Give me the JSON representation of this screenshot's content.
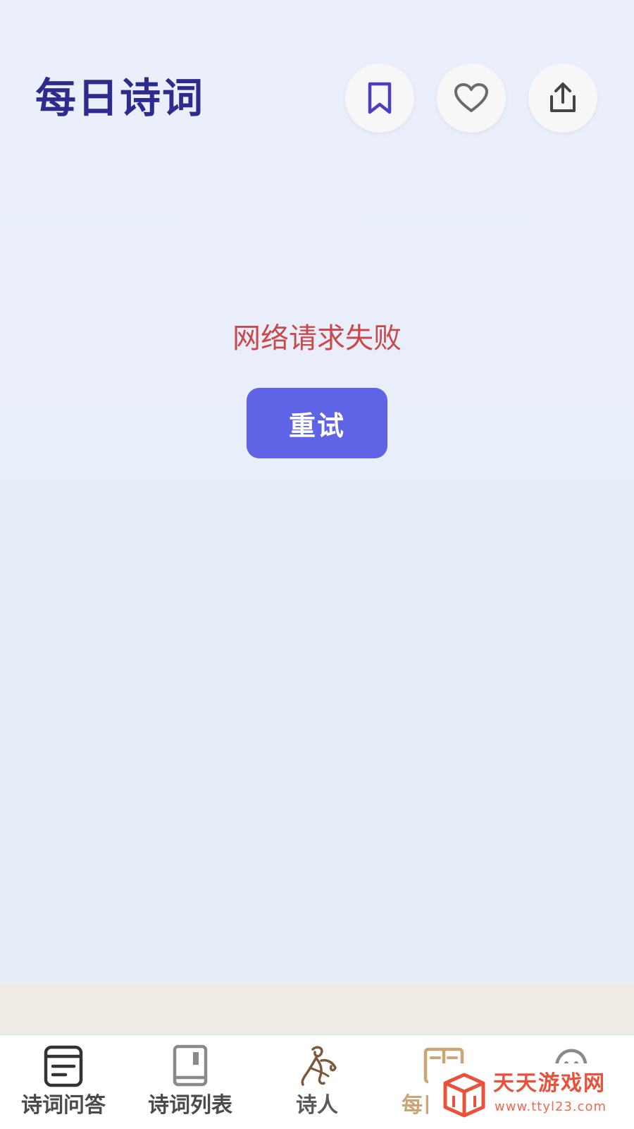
{
  "header": {
    "title": "每日诗词",
    "actions": [
      {
        "icon": "bookmark-icon",
        "color": "#4b3fbf"
      },
      {
        "icon": "heart-icon",
        "color": "#666666"
      },
      {
        "icon": "share-icon",
        "color": "#444444"
      }
    ]
  },
  "main": {
    "error_message": "网络请求失败",
    "retry_label": "重试"
  },
  "bottom_nav": {
    "items": [
      {
        "label": "诗词问答",
        "icon": "inbox-icon",
        "active": false
      },
      {
        "label": "诗词列表",
        "icon": "book-icon",
        "active": false
      },
      {
        "label": "诗人",
        "icon": "poet-icon",
        "active": false
      },
      {
        "label": "每日诗词",
        "icon": "open-book-icon",
        "active": true
      },
      {
        "label": "",
        "icon": "profile-icon",
        "active": false
      }
    ]
  },
  "watermark": {
    "brand": "天天游戏网",
    "url": "www.ttyl23.com"
  },
  "colors": {
    "title": "#2e2b8c",
    "error": "#c9494b",
    "accent": "#5f63e5",
    "active_tab": "#c9a577",
    "watermark": "#e8513a"
  }
}
